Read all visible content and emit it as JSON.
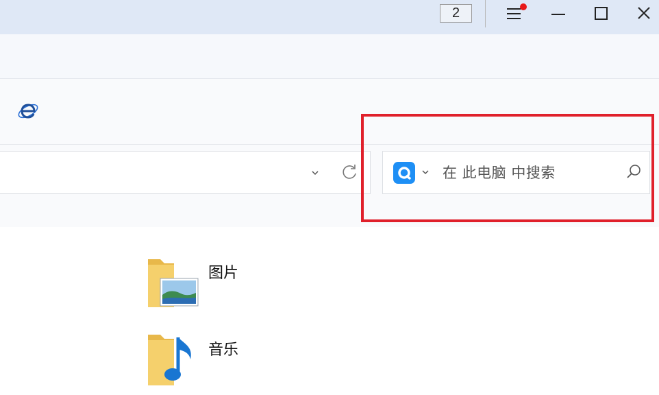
{
  "titlebar": {
    "tab_count": "2",
    "menu_icon": "hamburger-menu-icon",
    "menu_notification_color": "#e81a1a",
    "minimize_icon": "minimize-icon",
    "maximize_icon": "maximize-icon",
    "close_icon": "close-icon"
  },
  "toolbar": {
    "browser_icon": "ie-logo-icon"
  },
  "address_bar": {
    "value": "",
    "dropdown_icon": "chevron-down-icon",
    "refresh_icon": "refresh-icon"
  },
  "search": {
    "engine_icon": "search-engine-logo-icon",
    "engine_color": "#1e8ff5",
    "placeholder": "在 此电脑 中搜索",
    "search_icon": "search-icon"
  },
  "annotation": {
    "highlight_color": "#e0202b"
  },
  "folders": [
    {
      "label": "图片",
      "icon": "pictures-folder-icon"
    },
    {
      "label": "音乐",
      "icon": "music-folder-icon"
    }
  ]
}
